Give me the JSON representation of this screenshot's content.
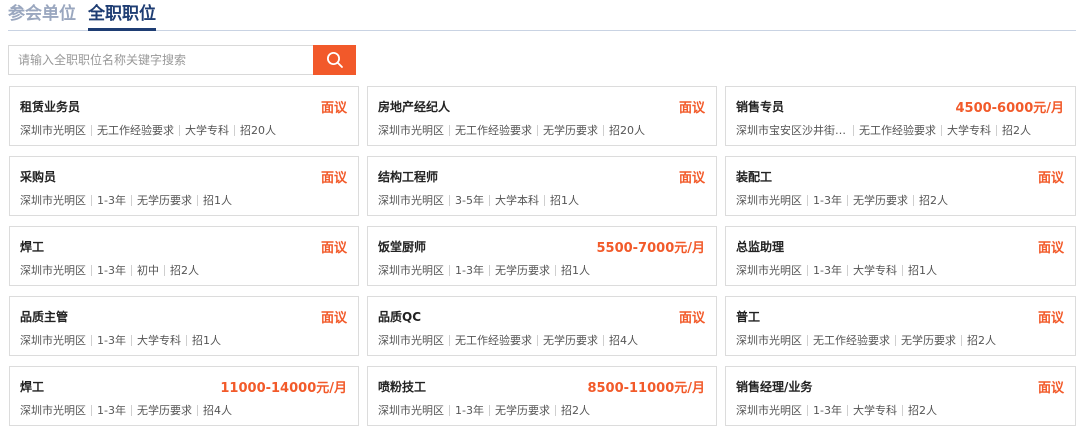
{
  "tabs": [
    {
      "label": "参会单位",
      "active": false
    },
    {
      "label": "全职职位",
      "active": true
    }
  ],
  "search": {
    "placeholder": "请输入全职职位名称关键字搜索",
    "button_icon": "search-icon"
  },
  "colors": {
    "accent": "#f2592a",
    "tab_active": "#1e3d73",
    "tab_inactive": "#9aa7bf"
  },
  "jobs": [
    {
      "title": "租赁业务员",
      "salary": "面议",
      "meta": [
        "深圳市光明区",
        "无工作经验要求",
        "大学专科",
        "招20人"
      ]
    },
    {
      "title": "房地产经纪人",
      "salary": "面议",
      "meta": [
        "深圳市光明区",
        "无工作经验要求",
        "无学历要求",
        "招20人"
      ]
    },
    {
      "title": "销售专员",
      "salary": "4500-6000元/月",
      "meta": [
        "深圳市宝安区沙井街道...",
        "无工作经验要求",
        "大学专科",
        "招2人"
      ]
    },
    {
      "title": "采购员",
      "salary": "面议",
      "meta": [
        "深圳市光明区",
        "1-3年",
        "无学历要求",
        "招1人"
      ]
    },
    {
      "title": "结构工程师",
      "salary": "面议",
      "meta": [
        "深圳市光明区",
        "3-5年",
        "大学本科",
        "招1人"
      ]
    },
    {
      "title": "装配工",
      "salary": "面议",
      "meta": [
        "深圳市光明区",
        "1-3年",
        "无学历要求",
        "招2人"
      ]
    },
    {
      "title": "焊工",
      "salary": "面议",
      "meta": [
        "深圳市光明区",
        "1-3年",
        "初中",
        "招2人"
      ]
    },
    {
      "title": "饭堂厨师",
      "salary": "5500-7000元/月",
      "meta": [
        "深圳市光明区",
        "1-3年",
        "无学历要求",
        "招1人"
      ]
    },
    {
      "title": "总监助理",
      "salary": "面议",
      "meta": [
        "深圳市光明区",
        "1-3年",
        "大学专科",
        "招1人"
      ]
    },
    {
      "title": "品质主管",
      "salary": "面议",
      "meta": [
        "深圳市光明区",
        "1-3年",
        "大学专科",
        "招1人"
      ]
    },
    {
      "title": "品质QC",
      "salary": "面议",
      "meta": [
        "深圳市光明区",
        "无工作经验要求",
        "无学历要求",
        "招4人"
      ]
    },
    {
      "title": "普工",
      "salary": "面议",
      "meta": [
        "深圳市光明区",
        "无工作经验要求",
        "无学历要求",
        "招2人"
      ]
    },
    {
      "title": "焊工",
      "salary": "11000-14000元/月",
      "meta": [
        "深圳市光明区",
        "1-3年",
        "无学历要求",
        "招4人"
      ]
    },
    {
      "title": "喷粉技工",
      "salary": "8500-11000元/月",
      "meta": [
        "深圳市光明区",
        "1-3年",
        "无学历要求",
        "招2人"
      ]
    },
    {
      "title": "销售经理/业务",
      "salary": "面议",
      "meta": [
        "深圳市光明区",
        "1-3年",
        "大学专科",
        "招2人"
      ]
    }
  ]
}
